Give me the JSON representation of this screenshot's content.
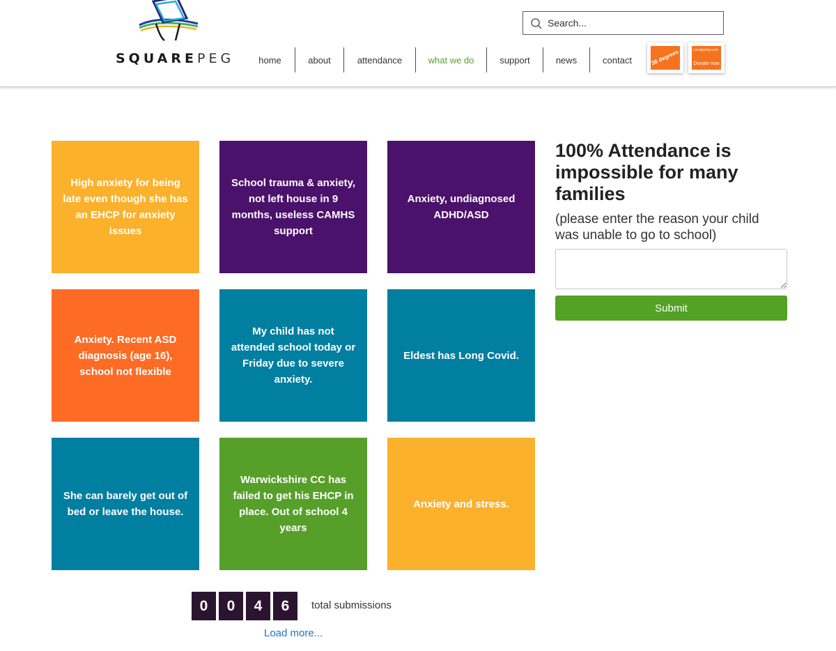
{
  "header": {
    "logo_text_bold": "SQUARE",
    "logo_text_light": "PEG",
    "search": {
      "placeholder": "Search..."
    },
    "nav": [
      {
        "label": "home"
      },
      {
        "label": "about"
      },
      {
        "label": "attendance"
      },
      {
        "label": "what we do",
        "active": true
      },
      {
        "label": "support"
      },
      {
        "label": "news"
      },
      {
        "label": "contact"
      }
    ],
    "badges": {
      "petition_text": "38 degrees",
      "donate_sub": "Localgiving.com",
      "donate_label": "Donate now"
    }
  },
  "colors": {
    "accent_green": "#5aa02c",
    "yellow": "#fbb12c",
    "purple": "#4a126b",
    "orange": "#fd6b25",
    "teal": "#017fa0",
    "green": "#56a02a",
    "counter_bg": "#2a1430",
    "link_blue": "#1d72c9"
  },
  "cards": [
    {
      "text": "High anxiety for being late even though she has an EHCP for anxiety issues",
      "color": "#fbb12c"
    },
    {
      "text": "School trauma & anxiety, not left house in 9 months, useless CAMHS support",
      "color": "#4a126b"
    },
    {
      "text": "Anxiety, undiagnosed ADHD/ASD",
      "color": "#4a126b"
    },
    {
      "text": "Anxiety. Recent ASD diagnosis (age 16), school not flexible",
      "color": "#fd6b25"
    },
    {
      "text": "My child has not attended school today or Friday due to severe anxiety.",
      "color": "#017fa0"
    },
    {
      "text": "Eldest has Long Covid.",
      "color": "#017fa0"
    },
    {
      "text": "She can barely get out of bed or leave the house.",
      "color": "#017fa0"
    },
    {
      "text": "Warwickshire CC has failed to get his EHCP in place. Out of school 4 years",
      "color": "#56a02a"
    },
    {
      "text": "Anxiety and stress.",
      "color": "#fbb12c"
    }
  ],
  "form": {
    "title": "100% Attendance is impossible for many families",
    "subtitle": "(please enter the reason your child was unable to go to school)",
    "input_value": "",
    "submit_label": "Submit"
  },
  "counter": {
    "digits": [
      "0",
      "0",
      "4",
      "6"
    ],
    "label": "total submissions"
  },
  "load_more": "Load more..."
}
